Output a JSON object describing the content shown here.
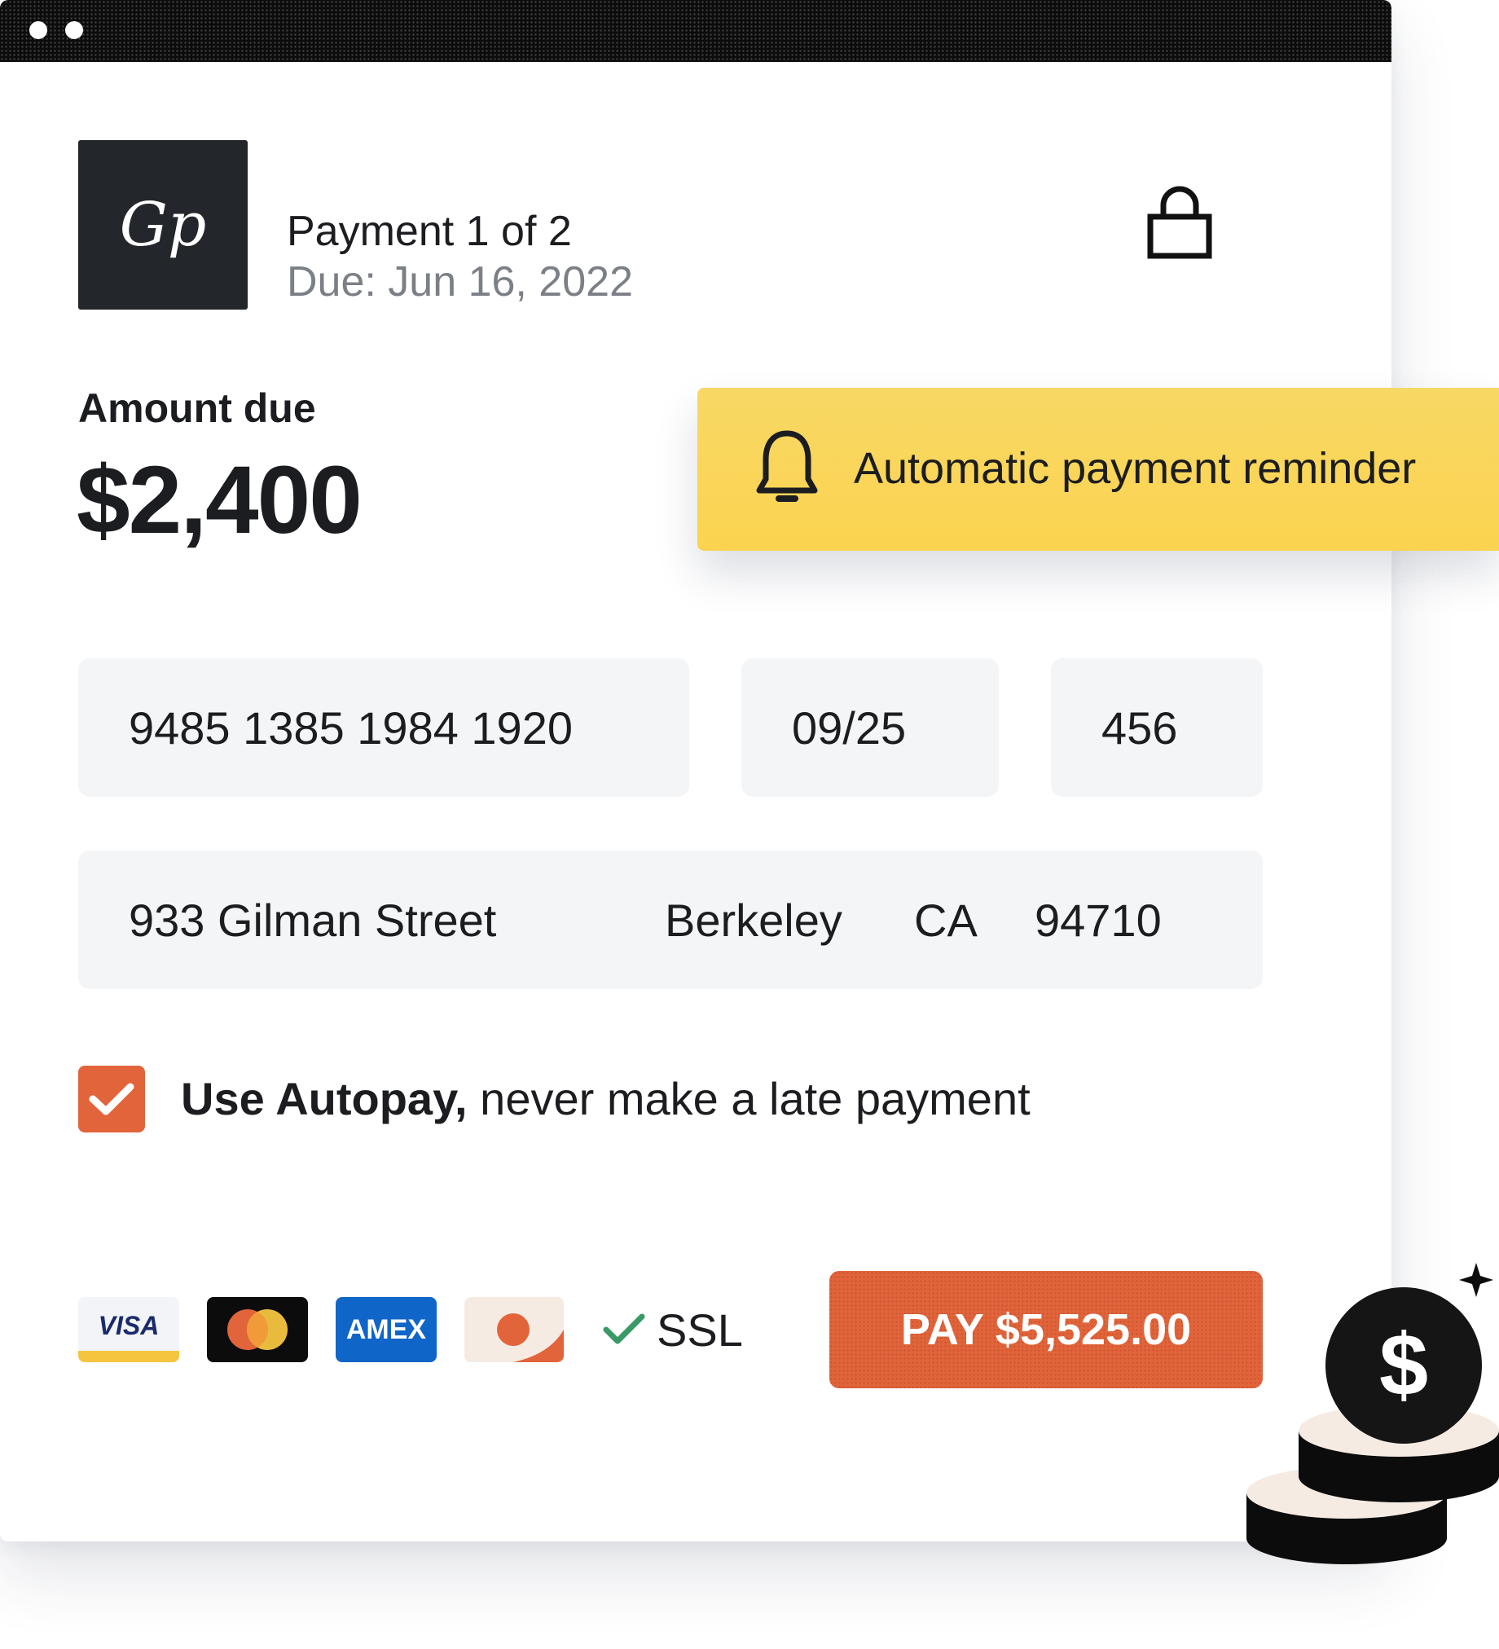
{
  "window": {
    "controls": [
      "window-dot",
      "window-dot"
    ]
  },
  "header": {
    "logo_text": "Gp",
    "payment_title": "Payment 1 of 2",
    "due_date": "Due: Jun 16, 2022",
    "lock_icon": "lock-icon"
  },
  "amount": {
    "label": "Amount due",
    "value": "$2,400"
  },
  "reminder": {
    "icon": "bell-icon",
    "text": "Automatic payment reminder"
  },
  "card": {
    "number": "9485 1385 1984 1920",
    "expiry": "09/25",
    "cvc": "456"
  },
  "address": {
    "street": "933 Gilman Street",
    "city": "Berkeley",
    "state": "CA",
    "zip": "94710"
  },
  "autopay": {
    "checked": true,
    "bold_text": "Use Autopay,",
    "text": " never make a late payment"
  },
  "payment_methods": [
    {
      "name": "visa-icon",
      "label": "VISA"
    },
    {
      "name": "mastercard-icon",
      "label": ""
    },
    {
      "name": "amex-icon",
      "label": "AMEX"
    },
    {
      "name": "discover-icon",
      "label": ""
    }
  ],
  "security": {
    "icon": "check-icon",
    "label": "SSL"
  },
  "pay_button": {
    "label": "PAY $5,525.00"
  },
  "colors": {
    "accent": "#e2643a",
    "reminder_bg": "#fbd350",
    "field_bg": "#f4f5f7",
    "text": "#1c1d20",
    "muted": "#7b7f86"
  }
}
